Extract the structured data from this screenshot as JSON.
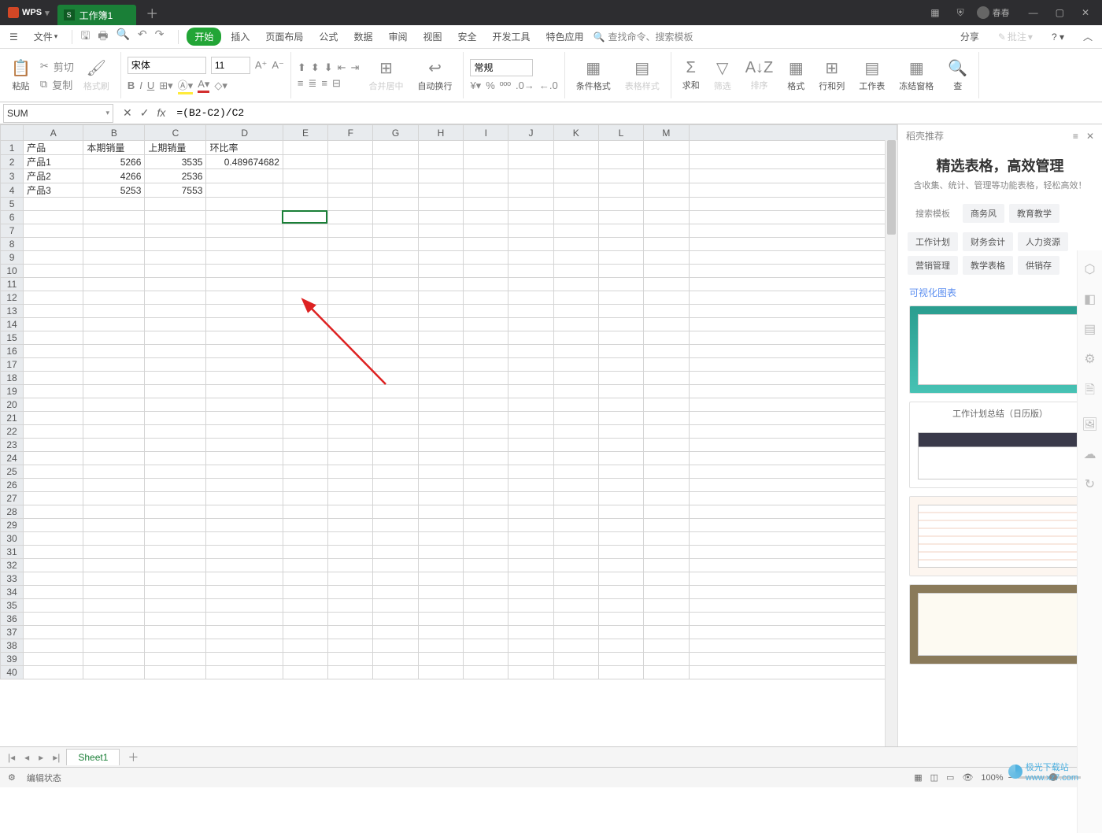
{
  "app": {
    "brand": "WPS",
    "tab_title": "工作簿1",
    "user_name": "春春"
  },
  "file_menu_label": "文件",
  "menu": {
    "start": "开始",
    "insert": "插入",
    "page_layout": "页面布局",
    "formula": "公式",
    "data": "数据",
    "review": "审阅",
    "view": "视图",
    "security": "安全",
    "dev": "开发工具",
    "special": "特色应用",
    "search_placeholder": "查找命令、搜索模板",
    "share": "分享",
    "note": "批注"
  },
  "ribbon": {
    "paste": "粘贴",
    "cut": "剪切",
    "copy": "复制",
    "format_painter": "格式刷",
    "font_name": "宋体",
    "font_size": "11",
    "merge_center": "合并居中",
    "wrap_text": "自动换行",
    "number_format": "常规",
    "cond_format": "条件格式",
    "table_style": "表格样式",
    "sum": "求和",
    "filter": "筛选",
    "sort": "排序",
    "format": "格式",
    "rowcol": "行和列",
    "worksheet": "工作表",
    "freeze": "冻结窗格",
    "find": "查"
  },
  "fx": {
    "name_box": "SUM",
    "formula": "=(B2-C2)/C2"
  },
  "columns": [
    "A",
    "B",
    "C",
    "D",
    "E",
    "F",
    "G",
    "H",
    "I",
    "J",
    "K",
    "L",
    "M"
  ],
  "data_cells": {
    "A1": "产品",
    "B1": "本期销量",
    "C1": "上期销量",
    "D1": "环比率",
    "A2": "产品1",
    "B2": "5266",
    "C2": "3535",
    "D2": "0.489674682",
    "A3": "产品2",
    "B3": "4266",
    "C3": "2536",
    "A4": "产品3",
    "B4": "5253",
    "C4": "7553"
  },
  "active_cell": "E6",
  "right_panel": {
    "header": "稻壳推荐",
    "title": "精选表格，高效管理",
    "subtitle": "含收集、统计、管理等功能表格，轻松高效！",
    "tags_top": [
      "搜索模板",
      "商务风",
      "教育教学"
    ],
    "tags_mid": [
      "工作计划",
      "财务会计",
      "人力资源",
      "营销管理",
      "教学表格",
      "供销存"
    ],
    "section": "可视化图表",
    "tpl2_label": "工作计划总结（日历版）"
  },
  "sheet_tab": "Sheet1",
  "status": {
    "mode": "编辑状态",
    "zoom": "100%",
    "cog": "⚙"
  },
  "watermark": {
    "site1": "极光下载站",
    "site2": "www.xz7.com"
  }
}
